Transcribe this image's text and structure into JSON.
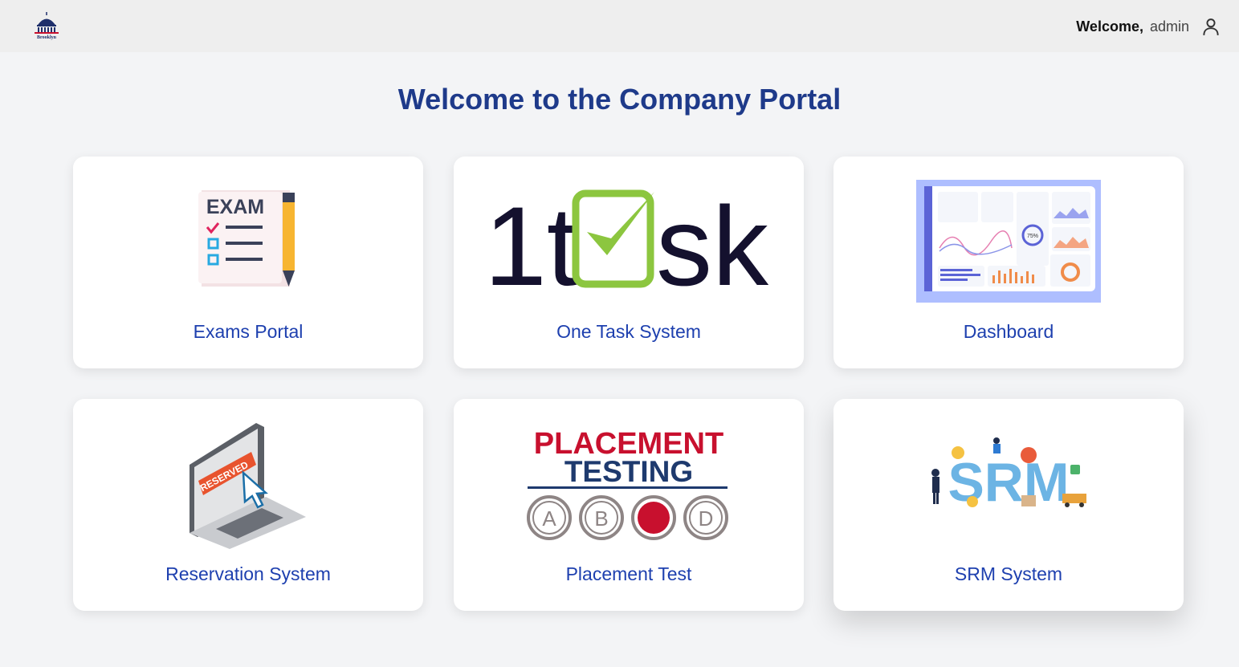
{
  "header": {
    "logo_text": "Brooklyn",
    "welcome_label": "Welcome,",
    "username": "admin",
    "logo_icon": "capitol-dome-icon",
    "user_icon": "user-icon"
  },
  "page": {
    "title": "Welcome to the Company Portal"
  },
  "cards": [
    {
      "label": "Exams Portal",
      "icon": "exam-checklist-icon",
      "art_text": "EXAM"
    },
    {
      "label": "One Task System",
      "icon": "one-task-logo",
      "art_text_a": "1t",
      "art_text_b": "sk"
    },
    {
      "label": "Dashboard",
      "icon": "dashboard-preview-image",
      "art_text": "75%"
    },
    {
      "label": "Reservation System",
      "icon": "reserved-laptop-icon",
      "art_text": "RESERVED"
    },
    {
      "label": "Placement Test",
      "icon": "placement-testing-logo",
      "art_text_a": "PLACEMENT",
      "art_text_b": "TESTING",
      "options": [
        "A",
        "B",
        "",
        "D"
      ]
    },
    {
      "label": "SRM System",
      "icon": "srm-illustration",
      "art_text": "SRM"
    }
  ],
  "colors": {
    "title": "#1e3a8a",
    "card_label": "#1e40af",
    "topbar": "#eeeeee",
    "background": "#f3f4f6",
    "placement_red": "#c8102e",
    "task_green": "#8cc63f"
  }
}
